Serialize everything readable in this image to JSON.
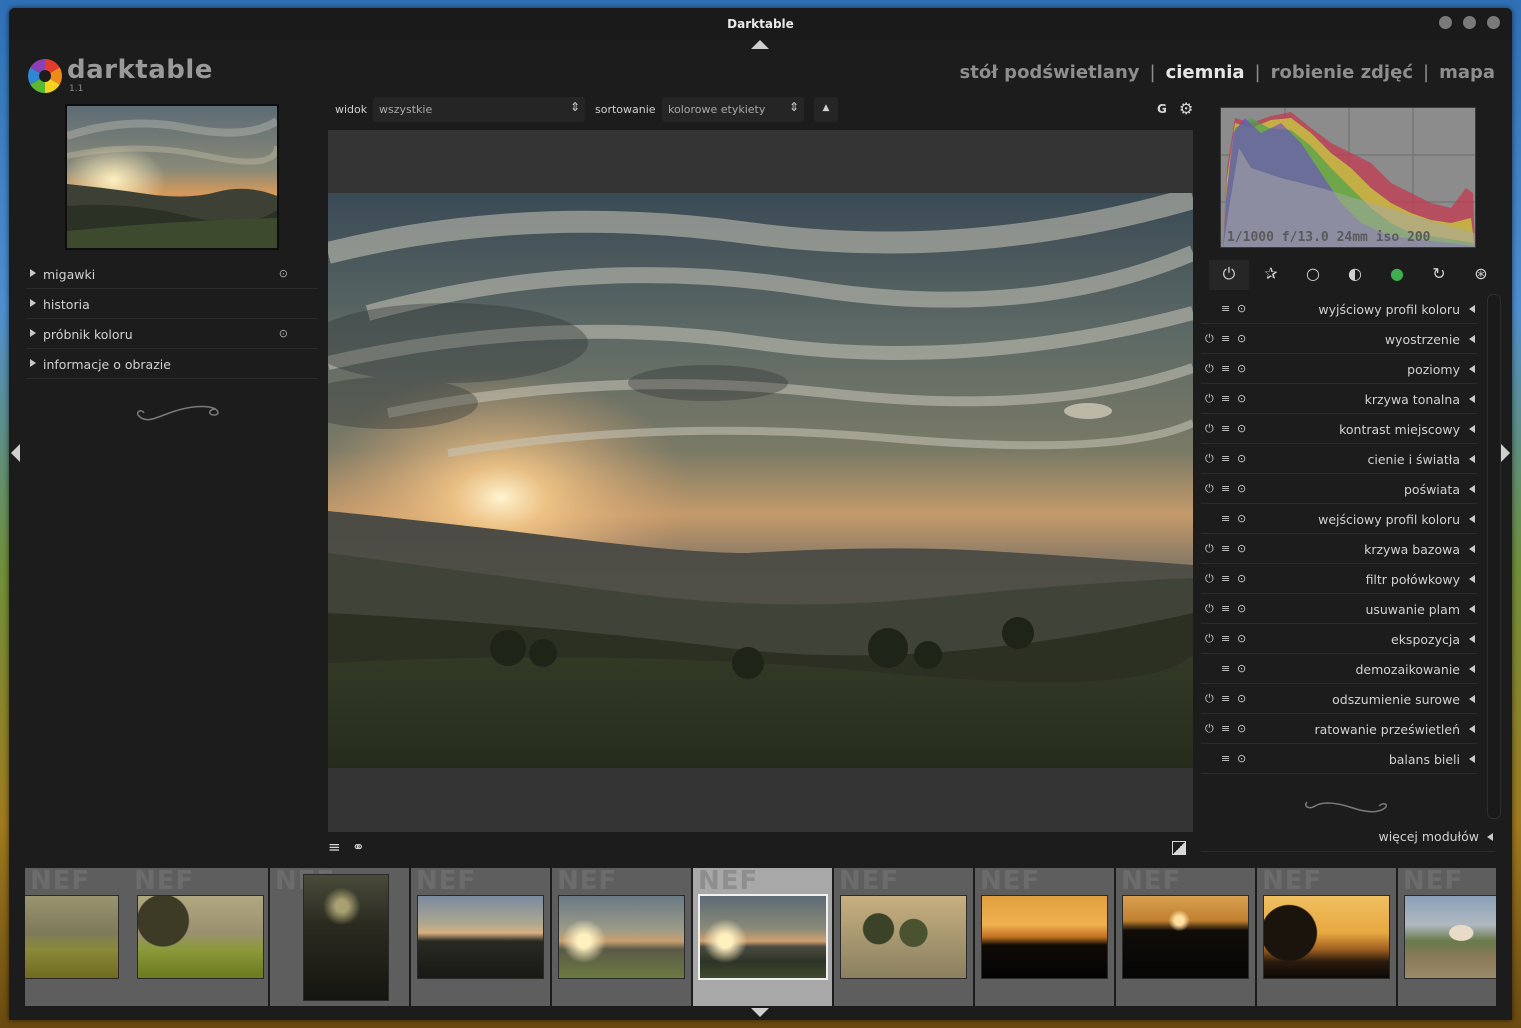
{
  "window": {
    "title": "Darktable"
  },
  "app": {
    "name": "darktable",
    "version": "1.1"
  },
  "views": [
    {
      "label": "stół podświetlany",
      "active": false
    },
    {
      "label": "ciemnia",
      "active": true
    },
    {
      "label": "robienie zdjęć",
      "active": false
    },
    {
      "label": "mapa",
      "active": false
    }
  ],
  "view_separator": "|",
  "left_panel": {
    "modules": [
      {
        "label": "migawki",
        "has_reset": true
      },
      {
        "label": "historia",
        "has_reset": false
      },
      {
        "label": "próbnik koloru",
        "has_reset": true
      },
      {
        "label": "informacje o obrazie",
        "has_reset": false
      }
    ]
  },
  "toolbar": {
    "view_label": "widok",
    "view_value": "wszystkie",
    "sort_label": "sortowanie",
    "sort_value": "kolorowe etykiety",
    "sort_dir": "▲",
    "grouping": "G"
  },
  "histogram": {
    "exif": "1/1000 f/13.0 24mm iso 200"
  },
  "module_groups": [
    {
      "icon": "power-icon",
      "glyph": "⏻",
      "selected": true
    },
    {
      "icon": "star-icon",
      "glyph": "✰",
      "selected": false
    },
    {
      "icon": "circle-icon",
      "glyph": "○",
      "selected": false
    },
    {
      "icon": "half-circle-icon",
      "glyph": "◐",
      "selected": false
    },
    {
      "icon": "color-wheel-icon",
      "glyph": "●",
      "selected": false
    },
    {
      "icon": "rotate-icon",
      "glyph": "↻",
      "selected": false
    },
    {
      "icon": "aperture-icon",
      "glyph": "⊛",
      "selected": false
    }
  ],
  "right_modules": [
    {
      "label": "wyjściowy profil koloru",
      "power": false
    },
    {
      "label": "wyostrzenie",
      "power": true
    },
    {
      "label": "poziomy",
      "power": true
    },
    {
      "label": "krzywa tonalna",
      "power": true
    },
    {
      "label": "kontrast miejscowy",
      "power": true
    },
    {
      "label": "cienie i światła",
      "power": true
    },
    {
      "label": "poświata",
      "power": true
    },
    {
      "label": "wejściowy profil koloru",
      "power": false
    },
    {
      "label": "krzywa bazowa",
      "power": true
    },
    {
      "label": "filtr połówkowy",
      "power": true
    },
    {
      "label": "usuwanie plam",
      "power": true
    },
    {
      "label": "ekspozycja",
      "power": true
    },
    {
      "label": "demozaikowanie",
      "power": false
    },
    {
      "label": "odszumienie surowe",
      "power": true
    },
    {
      "label": "ratowanie prześwietleń",
      "power": true
    },
    {
      "label": "balans bieli",
      "power": false
    }
  ],
  "more_modules": "więcej modułów",
  "filmstrip": {
    "badge": "NEF",
    "items": [
      {
        "kind": "foggy-field",
        "selected": false
      },
      {
        "kind": "tree-field",
        "selected": false
      },
      {
        "kind": "portrait-dark",
        "selected": false
      },
      {
        "kind": "dusk-hills",
        "selected": false
      },
      {
        "kind": "sunset-valley",
        "selected": false
      },
      {
        "kind": "sunset-valley-2",
        "selected": true
      },
      {
        "kind": "leaves",
        "selected": false
      },
      {
        "kind": "orange-sunset",
        "selected": false
      },
      {
        "kind": "orange-sunset-2",
        "selected": false
      },
      {
        "kind": "tree-sunset",
        "selected": false
      },
      {
        "kind": "house",
        "selected": false
      }
    ]
  },
  "colors": {
    "accent": "#e6e6e6",
    "panel": "#1c1c1c",
    "center": "#333333"
  }
}
